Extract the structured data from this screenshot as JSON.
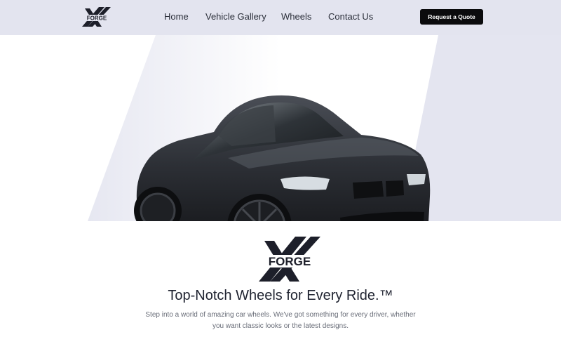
{
  "brand": {
    "logo_text": "FORGE"
  },
  "nav": {
    "items": [
      {
        "label": "Home"
      },
      {
        "label": "Vehicle Gallery"
      },
      {
        "label": "Wheels"
      },
      {
        "label": "Contact Us"
      }
    ],
    "cta_label": "Request a Quote"
  },
  "hero": {
    "image_subject": "black sports car with dark alloy wheels"
  },
  "content": {
    "headline": "Top-Notch Wheels for Every Ride.™",
    "subtext": "Step into a world of amazing car wheels. We've got something for every driver, whether you want classic looks or the latest designs."
  },
  "colors": {
    "header_bg": "#e3e4ef",
    "hero_shape": "#e4e5f0",
    "button_bg": "#0b0b0d",
    "text_dark": "#1f2330",
    "text_muted": "#6a6e79"
  }
}
